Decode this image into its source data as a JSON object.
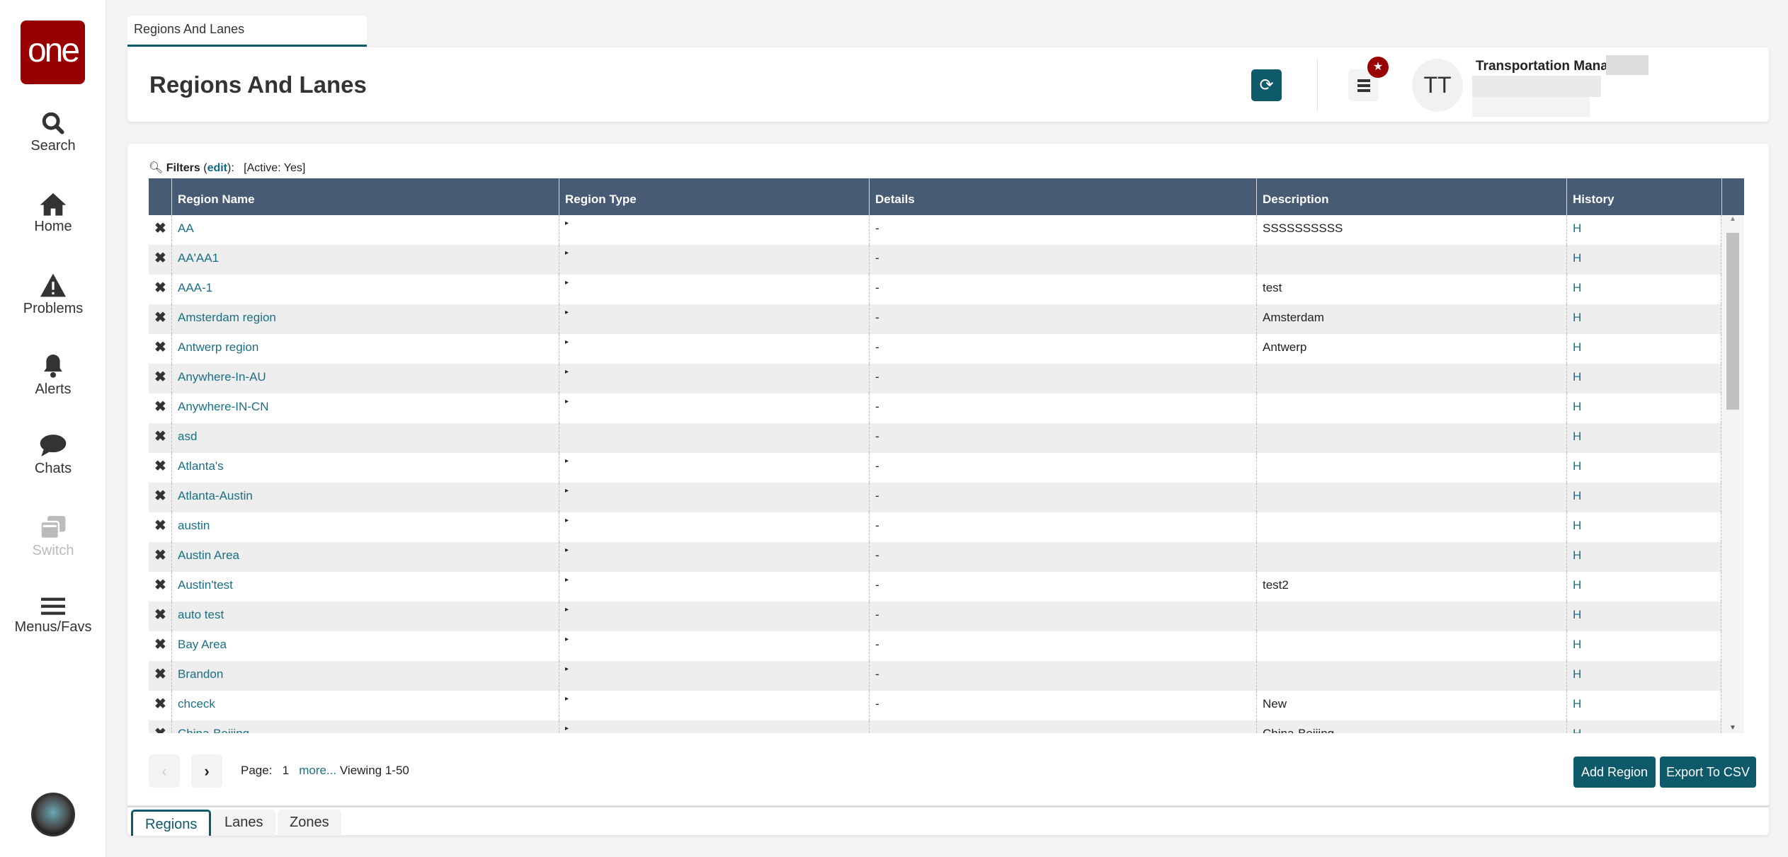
{
  "sidebar": {
    "logo": "one",
    "items": [
      {
        "label": "Search",
        "icon": "search-icon"
      },
      {
        "label": "Home",
        "icon": "home-icon"
      },
      {
        "label": "Problems",
        "icon": "warning-icon"
      },
      {
        "label": "Alerts",
        "icon": "bell-icon"
      },
      {
        "label": "Chats",
        "icon": "chat-icon"
      },
      {
        "label": "Switch",
        "icon": "switch-icon",
        "disabled": true
      },
      {
        "label": "Menus/Favs",
        "icon": "menu-icon"
      }
    ]
  },
  "tab": {
    "label": "Regions And Lanes"
  },
  "header": {
    "title": "Regions And Lanes",
    "user_role": "Transportation Manager",
    "user_initials": "TT"
  },
  "filters": {
    "label": "Filters",
    "edit": "edit",
    "active": "[Active: Yes]"
  },
  "table": {
    "columns": [
      "Region Name",
      "Region Type",
      "Details",
      "Description",
      "History"
    ],
    "rows": [
      {
        "name": "AA",
        "type": "▸",
        "details": "-",
        "desc": "SSSSSSSSSS",
        "history": "H"
      },
      {
        "name": "AA'AA1",
        "type": "▸",
        "details": "-",
        "desc": "",
        "history": "H"
      },
      {
        "name": "AAA-1",
        "type": "▸",
        "details": "-",
        "desc": "test",
        "history": "H"
      },
      {
        "name": "Amsterdam region",
        "type": "▸",
        "details": "-",
        "desc": "Amsterdam",
        "history": "H"
      },
      {
        "name": "Antwerp region",
        "type": "▸",
        "details": "-",
        "desc": "Antwerp",
        "history": "H"
      },
      {
        "name": "Anywhere-In-AU",
        "type": "▸",
        "details": "-",
        "desc": "",
        "history": "H"
      },
      {
        "name": "Anywhere-IN-CN",
        "type": "▸",
        "details": "-",
        "desc": "",
        "history": "H"
      },
      {
        "name": "asd",
        "type": "",
        "details": "-",
        "desc": "",
        "history": "H"
      },
      {
        "name": "Atlanta's",
        "type": "▸",
        "details": "-",
        "desc": "",
        "history": "H"
      },
      {
        "name": "Atlanta-Austin",
        "type": "▸",
        "details": "-",
        "desc": "",
        "history": "H"
      },
      {
        "name": "austin",
        "type": "▸",
        "details": "-",
        "desc": "",
        "history": "H"
      },
      {
        "name": "Austin Area",
        "type": "▸",
        "details": "-",
        "desc": "",
        "history": "H"
      },
      {
        "name": "Austin'test",
        "type": "▸",
        "details": "-",
        "desc": "test2",
        "history": "H"
      },
      {
        "name": "auto test",
        "type": "▸",
        "details": "-",
        "desc": "",
        "history": "H"
      },
      {
        "name": "Bay Area",
        "type": "▸",
        "details": "-",
        "desc": "",
        "history": "H"
      },
      {
        "name": "Brandon",
        "type": "▸",
        "details": "-",
        "desc": "",
        "history": "H"
      },
      {
        "name": "chceck",
        "type": "▸",
        "details": "-",
        "desc": "New",
        "history": "H"
      },
      {
        "name": "China-Beijing",
        "type": "▸",
        "details": "-",
        "desc": "China-Beijing",
        "history": "H"
      }
    ]
  },
  "paging": {
    "page_label": "Page:",
    "page": "1",
    "more": "more...",
    "viewing": "Viewing 1-50"
  },
  "actions": {
    "add": "Add Region",
    "export": "Export To CSV"
  },
  "bottom_tabs": [
    "Regions",
    "Lanes",
    "Zones"
  ],
  "colors": {
    "accent": "#0e5a6a",
    "brand": "#990000",
    "header": "#475b74",
    "link": "#1b6f85"
  }
}
